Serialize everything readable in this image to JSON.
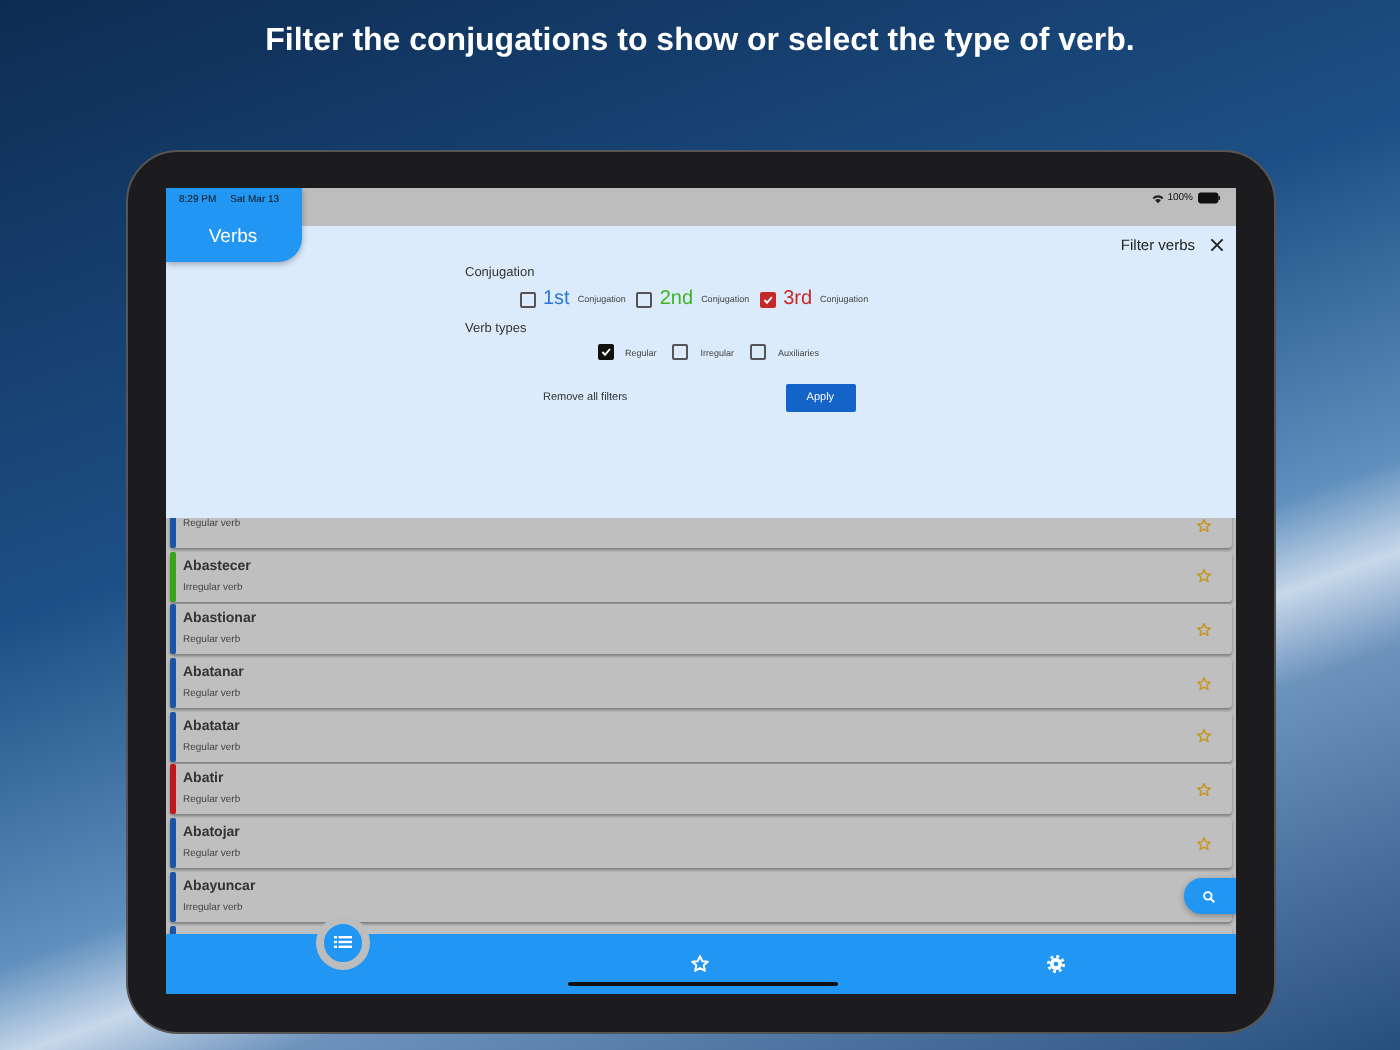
{
  "headline": "Filter the conjugations to show or select the type of verb.",
  "status_bar": {
    "time": "8:29 PM",
    "date": "Sat Mar 13",
    "battery": "100%"
  },
  "app_tab": {
    "label": "Verbs"
  },
  "filter_panel": {
    "title": "Filter verbs",
    "conjugation_label": "Conjugation",
    "conjugations": [
      {
        "number": "1st",
        "label": "Conjugation",
        "checked": false,
        "color": "#2a78d6"
      },
      {
        "number": "2nd",
        "label": "Conjugation",
        "checked": false,
        "color": "#3cb520"
      },
      {
        "number": "3rd",
        "label": "Conjugation",
        "checked": true,
        "color": "#c62828"
      }
    ],
    "verb_types_label": "Verb types",
    "verb_types": [
      {
        "label": "Regular",
        "checked": true
      },
      {
        "label": "Irregular",
        "checked": false
      },
      {
        "label": "Auxiliaries",
        "checked": false
      }
    ],
    "remove_button": "Remove all filters",
    "apply_button": "Apply"
  },
  "verbs": [
    {
      "subtitle": "Regular verb",
      "color": "#1a55a6"
    },
    {
      "name": "Abastecer",
      "subtitle": "Irregular verb",
      "color": "#3aa319"
    },
    {
      "name": "Abastionar",
      "subtitle": "Regular verb",
      "color": "#1a55a6"
    },
    {
      "name": "Abatanar",
      "subtitle": "Regular verb",
      "color": "#1a55a6"
    },
    {
      "name": "Abatatar",
      "subtitle": "Regular verb",
      "color": "#1a55a6"
    },
    {
      "name": "Abatir",
      "subtitle": "Regular verb",
      "color": "#c0161c"
    },
    {
      "name": "Abatojar",
      "subtitle": "Regular verb",
      "color": "#1a55a6"
    },
    {
      "name": "Abayuncar",
      "subtitle": "Irregular verb",
      "color": "#1a55a6"
    },
    {
      "color": "#1a55a6"
    }
  ],
  "nav": [
    {
      "kind": "list",
      "selected": true
    },
    {
      "kind": "star",
      "selected": false
    },
    {
      "kind": "settings",
      "selected": false
    }
  ]
}
